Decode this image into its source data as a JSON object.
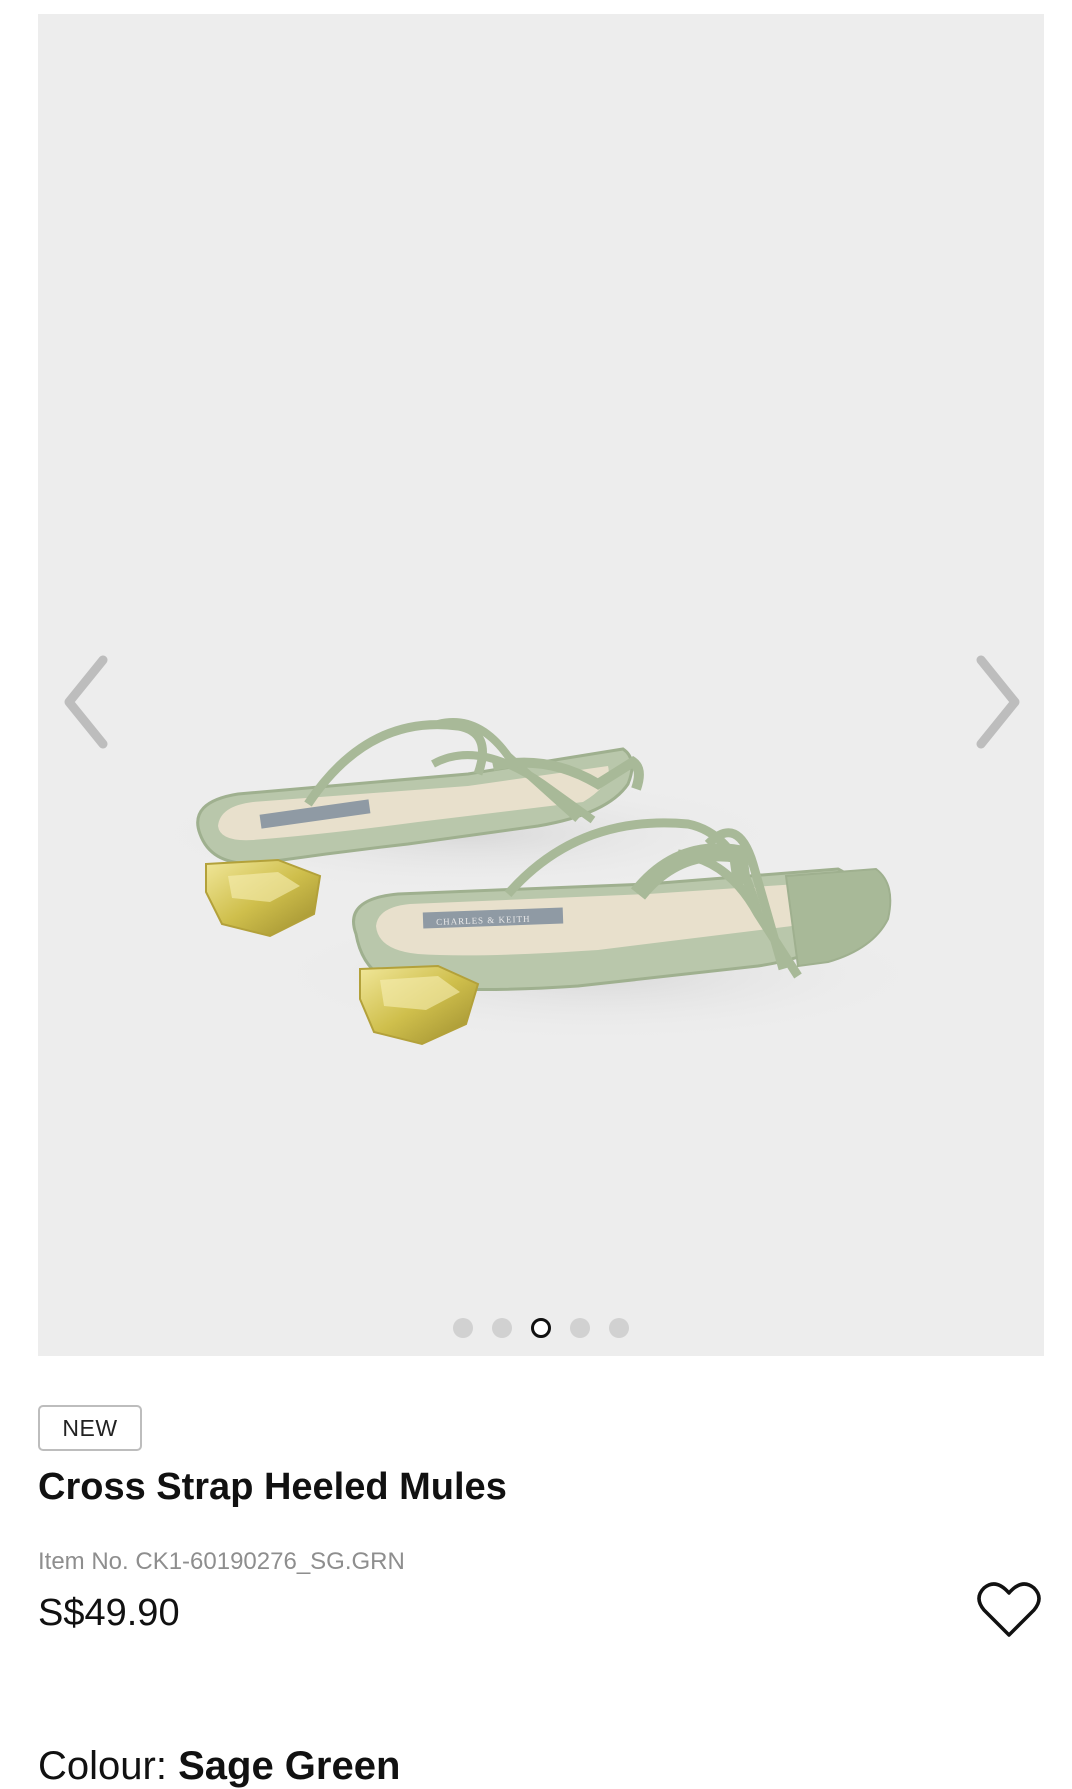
{
  "gallery": {
    "image_alt": "Product image",
    "prev_icon": "chevron-left-icon",
    "next_icon": "chevron-right-icon",
    "dot_count": 5,
    "active_index": 2,
    "shoe_label": "CHARLES & KEITH"
  },
  "product": {
    "badge": "NEW",
    "title": "Cross Strap Heeled Mules",
    "item_no": "Item No. CK1-60190276_SG.GRN",
    "price": "S$49.90",
    "wishlist_icon": "heart-outline-icon",
    "colour_label": "Colour:",
    "colour_value": "Sage Green"
  },
  "colors": {
    "background": "#ffffff",
    "image_background": "#ededed",
    "strap": "#a8b998",
    "heel_gold": "#d8c860",
    "dot_inactive": "#d1d1d1",
    "text_secondary": "#8e8e8e"
  }
}
